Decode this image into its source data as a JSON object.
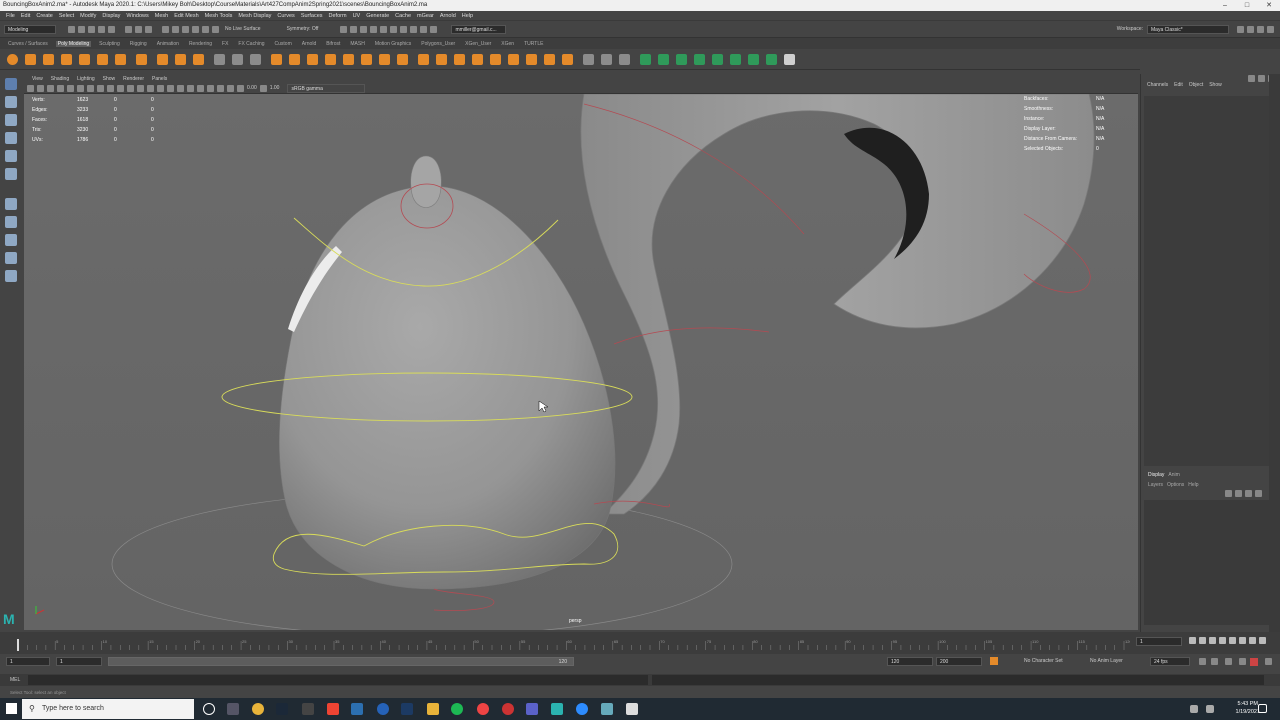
{
  "titlebar": {
    "title": "BouncingBoxAnim2.ma* - Autodesk Maya 2020.1: C:\\Users\\Mikey Boh\\Desktop\\CourseMaterials\\Art427CompAnim2Spring2021\\scenes\\BouncingBoxAnim2.ma"
  },
  "menubar": {
    "items": [
      "File",
      "Edit",
      "Create",
      "Select",
      "Modify",
      "Display",
      "Windows",
      "Mesh",
      "Edit Mesh",
      "Mesh Tools",
      "Mesh Display",
      "Curves",
      "Surfaces",
      "Deform",
      "UV",
      "Generate",
      "Cache",
      "mGear",
      "Arnold",
      "Help"
    ]
  },
  "statusline": {
    "mode": "Modeling",
    "live_surface": "No Live Surface",
    "symmetry": "Symmetry: Off",
    "account": "mmiller@gmail.c...",
    "workspace_label": "Workspace:",
    "workspace": "Maya Classic*"
  },
  "shelf_tabs": {
    "items": [
      "Curves / Surfaces",
      "Poly Modeling",
      "Sculpting",
      "Rigging",
      "Animation",
      "Rendering",
      "FX",
      "FX Caching",
      "Custom",
      "Arnold",
      "Bifrost",
      "MASH",
      "Motion Graphics",
      "Polygons_User",
      "XGen_User",
      "XGen",
      "TURTLE"
    ],
    "active": "Poly Modeling"
  },
  "panel_menu": {
    "items": [
      "View",
      "Shading",
      "Lighting",
      "Show",
      "Renderer",
      "Panels"
    ]
  },
  "panel_toolbar": {
    "value1": "0.00",
    "value2": "1.00",
    "colorspace": "sRGB gamma"
  },
  "hud_left": {
    "rows": [
      {
        "label": "Verts:",
        "a": "1623",
        "b": "0",
        "c": "0"
      },
      {
        "label": "Edges:",
        "a": "3233",
        "b": "0",
        "c": "0"
      },
      {
        "label": "Faces:",
        "a": "1618",
        "b": "0",
        "c": "0"
      },
      {
        "label": "Tris:",
        "a": "3230",
        "b": "0",
        "c": "0"
      },
      {
        "label": "UVs:",
        "a": "1786",
        "b": "0",
        "c": "0"
      }
    ]
  },
  "hud_right": {
    "rows": [
      {
        "label": "Backfaces:",
        "value": "N/A"
      },
      {
        "label": "Smoothness:",
        "value": "N/A"
      },
      {
        "label": "Instance:",
        "value": "N/A"
      },
      {
        "label": "Display Layer:",
        "value": "N/A"
      },
      {
        "label": "Distance From Camera:",
        "value": "N/A"
      },
      {
        "label": "Selected Objects:",
        "value": "0"
      }
    ]
  },
  "camera": "persp",
  "channel_box": {
    "menu": [
      "Channels",
      "Edit",
      "Object",
      "Show"
    ]
  },
  "layer_editor": {
    "tabs": [
      "Display",
      "Anim"
    ],
    "menu": [
      "Layers",
      "Options",
      "Help"
    ]
  },
  "timeline": {
    "current_frame": "1",
    "ticks": [
      "5",
      "10",
      "15",
      "20",
      "25",
      "30",
      "35",
      "40",
      "45",
      "50",
      "55",
      "60",
      "65",
      "70",
      "75",
      "80",
      "85",
      "90",
      "95",
      "100",
      "105",
      "110",
      "115",
      "120"
    ]
  },
  "range_slider": {
    "start": "1",
    "inner_start": "1",
    "inner_end": "120",
    "end": "120",
    "max": "200",
    "character_set": "No Character Set",
    "anim_layer": "No Anim Layer",
    "fps": "24 fps"
  },
  "command_line": {
    "label": "MEL"
  },
  "help_line": "Select Tool: select an object",
  "taskbar": {
    "search_placeholder": "Type here to search",
    "time": "5:43 PM",
    "date": "1/19/2021"
  },
  "colors": {
    "accent_orange": "#e48a2a",
    "hud_text": "#ffffff",
    "nurbs_yellow": "#d9dc5a",
    "nurbs_red": "#b44a52"
  }
}
